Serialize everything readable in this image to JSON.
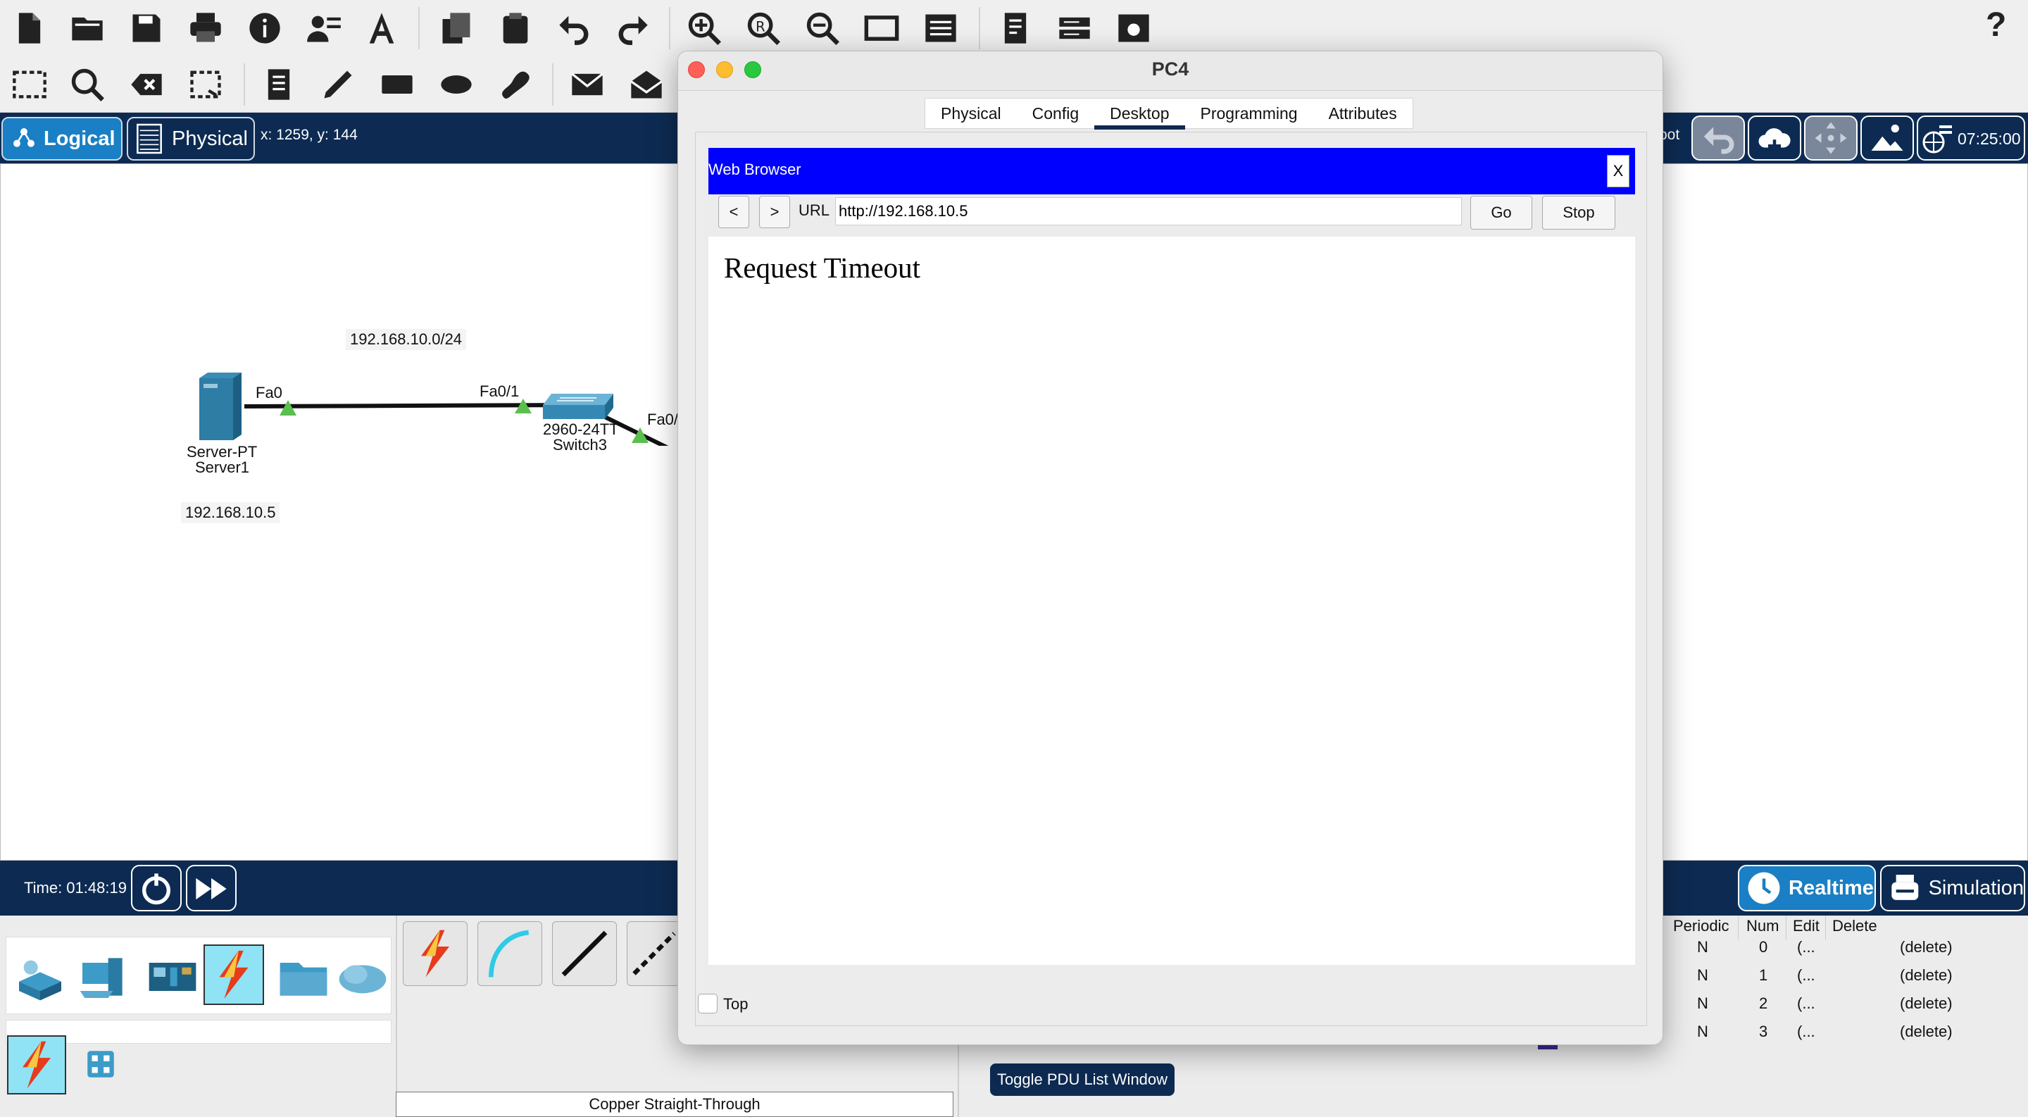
{
  "toolbar1": {
    "icons": [
      "new-file",
      "open-folder",
      "save",
      "print",
      "info",
      "user-settings",
      "text-tool",
      "copy",
      "paste",
      "undo",
      "redo",
      "zoom-in",
      "zoom-reset",
      "zoom-out",
      "rectangle-view",
      "palette",
      "list",
      "network-device",
      "router-window"
    ],
    "help_label": "?"
  },
  "toolbar2": {
    "icons": [
      "select",
      "inspect",
      "delete",
      "resize",
      "note",
      "pencil",
      "rectangle",
      "ellipse",
      "freeform",
      "mail-closed",
      "mail-open"
    ]
  },
  "nav": {
    "logical_label": "Logical",
    "physical_label": "Physical",
    "coords": "x: 1259, y: 144",
    "root_label": "oot",
    "clock": "07:25:00"
  },
  "topology": {
    "network_label": "192.168.10.0/24",
    "server": {
      "port": "Fa0",
      "model": "Server-PT",
      "name": "Server1",
      "ip": "192.168.10.5"
    },
    "switch": {
      "port_left": "Fa0/1",
      "port_right": "Fa0/",
      "model": "2960-24TT",
      "name": "Switch3"
    }
  },
  "timebar": {
    "time": "Time: 01:48:19",
    "realtime_label": "Realtime",
    "simulation_label": "Simulation"
  },
  "bottom": {
    "cable_label": "Copper Straight-Through",
    "toggle_pdu_label": "Toggle PDU List Window",
    "pdu_headers": [
      "Periodic",
      "Num",
      "Edit",
      "Delete"
    ],
    "pdu_rows": [
      {
        "periodic": "N",
        "num": "0",
        "edit": "(...",
        "delete": "(delete)"
      },
      {
        "periodic": "N",
        "num": "1",
        "edit": "(...",
        "delete": "(delete)"
      },
      {
        "periodic": "N",
        "num": "2",
        "edit": "(...",
        "delete": "(delete)"
      },
      {
        "periodic": "N",
        "num": "3",
        "edit": "(...",
        "delete": "(delete)"
      }
    ]
  },
  "modal": {
    "title": "PC4",
    "tabs": [
      "Physical",
      "Config",
      "Desktop",
      "Programming",
      "Attributes"
    ],
    "active_tab": "Desktop",
    "browser": {
      "title": "Web Browser",
      "close_label": "X",
      "back_label": "<",
      "forward_label": ">",
      "url_label": "URL",
      "url_value": "http://192.168.10.5",
      "go_label": "Go",
      "stop_label": "Stop",
      "message": "Request Timeout"
    },
    "top_label": "Top"
  },
  "colors": {
    "nav_bg": "#0d2b52",
    "browser_title_bg": "#0000ff",
    "link_green": "#4caf50"
  }
}
